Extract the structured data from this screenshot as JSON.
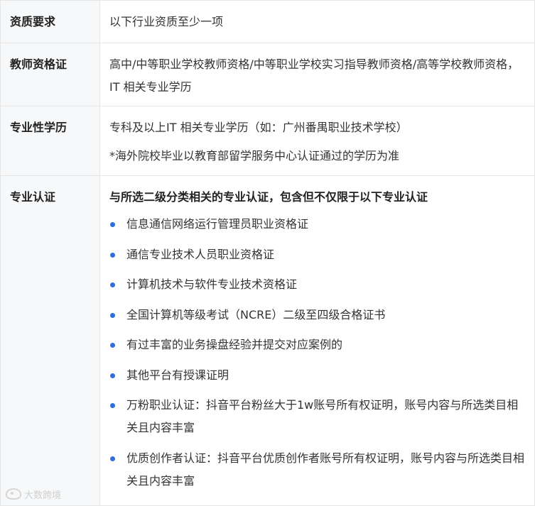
{
  "rows": [
    {
      "label": "资质要求",
      "text": "以下行业资质至少一项"
    },
    {
      "label": "教师资格证",
      "text": "高中/中等职业学校教师资格/中等职业学校实习指导教师资格/高等学校教师资格，IT 相关专业学历"
    },
    {
      "label": "专业性学历",
      "text": "专科及以上IT 相关专业学历（如：广州番禺职业技术学校）",
      "note": "*海外院校毕业以教育部留学服务中心认证通过的学历为准"
    },
    {
      "label": "专业认证",
      "heading": "与所选二级分类相关的专业认证，包含但不仅限于以下专业认证",
      "items": [
        "信息通信网络运行管理员职业资格证",
        "通信专业技术人员职业资格证",
        "计算机技术与软件专业技术资格证",
        "全国计算机等级考试（NCRE）二级至四级合格证书",
        "有过丰富的业务操盘经验并提交对应案例的",
        "其他平台有授课证明",
        "万粉职业认证：抖音平台粉丝大于1w账号所有权证明，账号内容与所选类目相关且内容丰富",
        "优质创作者认证：抖音平台优质创作者账号所有权证明，账号内容与所选类目相关且内容丰富"
      ]
    }
  ],
  "watermark": {
    "text": "大数跨境",
    "icon": "brand-logo-icon"
  },
  "colors": {
    "bullet": "#2e6ee0",
    "label_bg": "#f7f8fa",
    "border": "#e6e6e6"
  }
}
